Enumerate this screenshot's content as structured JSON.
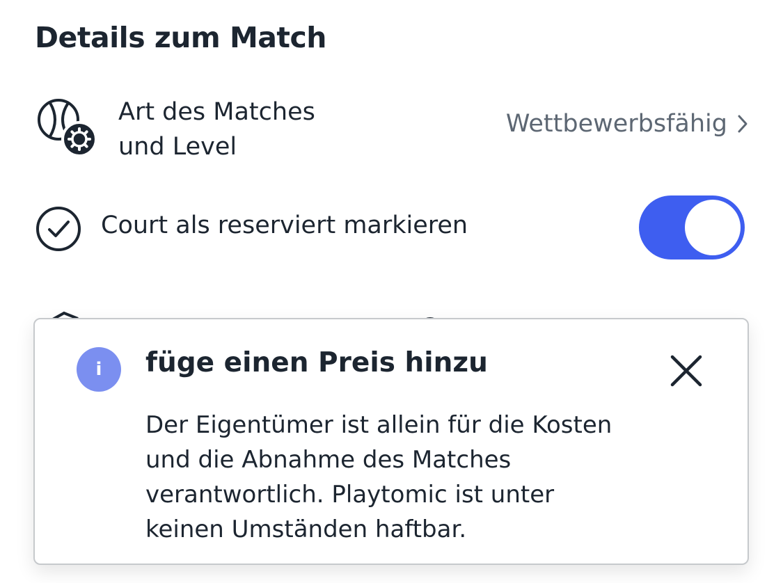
{
  "section": {
    "title": "Details zum Match"
  },
  "match_type": {
    "icon": "tennis-ball-gear-icon",
    "label_line1": "Art des Matches",
    "label_line2": "und Level",
    "value": "Wettbewerbsfähig",
    "chevron_icon": "chevron-right-icon"
  },
  "reserve": {
    "icon": "check-circle-icon",
    "label": "Court als reserviert markieren",
    "toggle_on": true
  },
  "tooltip": {
    "info_icon_glyph": "i",
    "title": "füge einen Preis hinzu",
    "close_icon": "close-icon",
    "body_lines": [
      "Der Eigentümer ist allein für die Kosten",
      "und die Abnahme des Matches",
      "verantwortlich. Playtomic ist unter",
      "keinen Umständen haftbar."
    ]
  },
  "colors": {
    "text": "#1c2530",
    "muted": "#5d6773",
    "toggle_on": "#3e5ef0",
    "info_badge": "#7b8ff0",
    "tooltip_border": "#c6c9cc"
  }
}
